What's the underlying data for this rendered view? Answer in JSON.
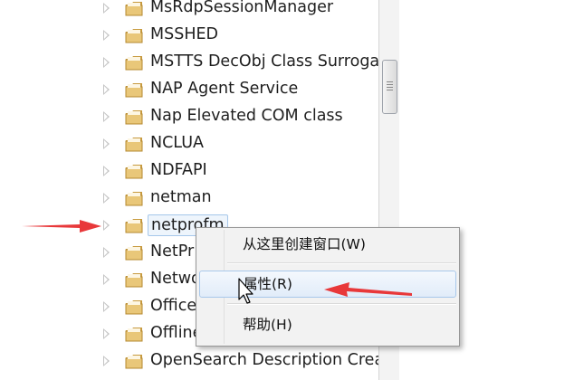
{
  "tree": {
    "items": [
      {
        "label": "MsRdpSessionManager"
      },
      {
        "label": "MSSHED"
      },
      {
        "label": "MSTTS DecObj Class Surroga"
      },
      {
        "label": "NAP Agent Service"
      },
      {
        "label": "Nap Elevated COM class"
      },
      {
        "label": "NCLUA"
      },
      {
        "label": "NDFAPI"
      },
      {
        "label": "netman"
      },
      {
        "label": "netprofm"
      },
      {
        "label": "NetPr"
      },
      {
        "label": "Netwo"
      },
      {
        "label": "Office"
      },
      {
        "label": "Offline"
      },
      {
        "label": "OpenSearch Description Crea"
      }
    ],
    "selected_index": 8
  },
  "context_menu": {
    "items": [
      {
        "label": "从这里创建窗口(W)"
      },
      {
        "label": "属性(R)"
      },
      {
        "label": "帮助(H)"
      }
    ],
    "hover_index": 1
  },
  "colors": {
    "annotation_arrow": "#e8383a",
    "folder_body": "#e9c779",
    "folder_dark": "#c79a3e",
    "selection_border": "#a6c7ea"
  },
  "icons": {
    "tree_node": "folder-icon",
    "expander": "expand-triangle-icon",
    "pointer": "mouse-cursor-icon"
  }
}
